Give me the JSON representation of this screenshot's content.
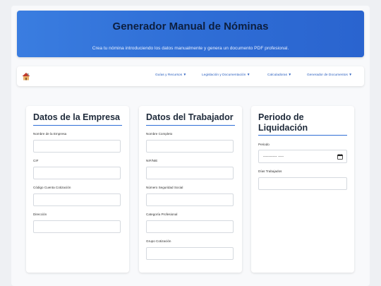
{
  "header": {
    "title": "Generador Manual de Nóminas",
    "subtitle": "Crea tu nómina introduciendo los datos manualmente y genera un documento PDF profesional."
  },
  "nav": {
    "home_icon": "house-icon",
    "items": [
      {
        "label": "Guías y Recursos ▼"
      },
      {
        "label": "Legislación y Documentación ▼"
      },
      {
        "label": "Calculadoras ▼"
      },
      {
        "label": "Generador de Documentos ▼"
      }
    ]
  },
  "empresa": {
    "title": "Datos de la Empresa",
    "fields": [
      {
        "label": "Nombre de la Empresa",
        "value": ""
      },
      {
        "label": "CIF",
        "value": ""
      },
      {
        "label": "Código Cuenta Cotización",
        "value": ""
      },
      {
        "label": "Dirección",
        "value": ""
      }
    ]
  },
  "trabajador": {
    "title": "Datos del Trabajador",
    "fields": [
      {
        "label": "Nombre Completo",
        "value": ""
      },
      {
        "label": "NIF/NIE",
        "value": ""
      },
      {
        "label": "Número Seguridad Social",
        "value": ""
      },
      {
        "label": "Categoría Profesional",
        "value": ""
      },
      {
        "label": "Grupo Cotización",
        "value": ""
      }
    ]
  },
  "periodo": {
    "title_line1": "Periodo de",
    "title_line2": "Liquidación",
    "periodo_label": "Periodo",
    "periodo_value": "---------- ----",
    "dias_label": "Días Trabajados",
    "dias_value": ""
  },
  "colors": {
    "accent": "#2f6ed6",
    "header_title": "#0d1f3f"
  }
}
